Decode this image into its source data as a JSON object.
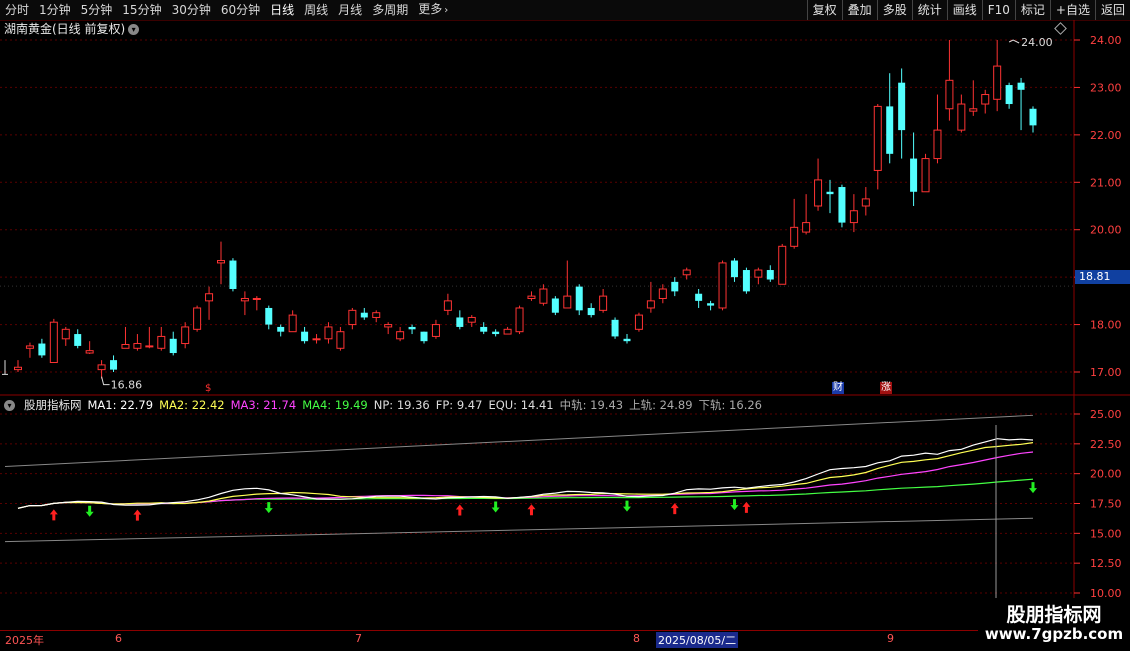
{
  "toolbar": {
    "tabs": [
      "分时",
      "1分钟",
      "5分钟",
      "15分钟",
      "30分钟",
      "60分钟",
      "日线",
      "周线",
      "月线",
      "多周期",
      "更多"
    ],
    "active_tab": "日线",
    "right_buttons": [
      "复权",
      "叠加",
      "多股",
      "统计",
      "画线",
      "F10",
      "标记",
      "+自选",
      "返回"
    ]
  },
  "header": {
    "title": "湖南黄金(日线 前复权)"
  },
  "indicator": {
    "name": "股朋指标网",
    "items": [
      {
        "label": "MA1: 22.79",
        "color": "#ffffff"
      },
      {
        "label": "MA2: 22.42",
        "color": "#ffff55"
      },
      {
        "label": "MA3: 21.74",
        "color": "#ff44ff"
      },
      {
        "label": "MA4: 19.49",
        "color": "#44ff44"
      },
      {
        "label": "NP: 19.36",
        "color": "#dddddd"
      },
      {
        "label": "FP: 9.47",
        "color": "#dddddd"
      },
      {
        "label": "EQU: 14.41",
        "color": "#dddddd"
      },
      {
        "label": "中轨: 19.43",
        "color": "#aaaaaa"
      },
      {
        "label": "上轨: 24.89",
        "color": "#aaaaaa"
      },
      {
        "label": "下轨: 16.26",
        "color": "#aaaaaa"
      }
    ]
  },
  "price_axis": [
    "24.00",
    "23.00",
    "22.00",
    "21.00",
    "20.00",
    "19.00",
    "18.00",
    "17.00"
  ],
  "indicator_axis": [
    "25.00",
    "22.50",
    "20.00",
    "17.50",
    "15.00",
    "12.50",
    "10.00"
  ],
  "current_price": "18.81",
  "high_label": "24.00",
  "low_label": "16.86",
  "badges": {
    "cai": "财",
    "zhang": "涨"
  },
  "dates": {
    "year": "2025年",
    "m6": "6",
    "m7": "7",
    "m8": "8",
    "m9": "9",
    "selected": "2025/08/05/二"
  },
  "watermark": {
    "line1": "股朋指标网",
    "line2": "www.7gpzb.com"
  },
  "colors": {
    "up": "#ff3333",
    "down": "#54ffff",
    "grid": "#5a0000"
  },
  "chart_data": {
    "type": "candlestick",
    "price_range": [
      16.6,
      24.4
    ],
    "indicator_range": [
      10,
      25.5
    ],
    "candles": [
      [
        17.05,
        17.1,
        17.25,
        17.0
      ],
      [
        17.5,
        17.55,
        17.62,
        17.3
      ],
      [
        17.6,
        17.35,
        17.7,
        17.3
      ],
      [
        17.2,
        18.05,
        18.12,
        17.2
      ],
      [
        17.7,
        17.9,
        17.95,
        17.55
      ],
      [
        17.8,
        17.55,
        17.9,
        17.5
      ],
      [
        17.4,
        17.45,
        17.65,
        17.38
      ],
      [
        17.05,
        17.15,
        17.25,
        16.86
      ],
      [
        17.25,
        17.05,
        17.35,
        17.0
      ],
      [
        17.5,
        17.58,
        17.95,
        17.5
      ],
      [
        17.5,
        17.6,
        17.8,
        17.45
      ],
      [
        17.55,
        17.55,
        17.95,
        17.5
      ],
      [
        17.5,
        17.75,
        17.95,
        17.45
      ],
      [
        17.7,
        17.4,
        17.85,
        17.35
      ],
      [
        17.6,
        17.95,
        18.05,
        17.5
      ],
      [
        17.9,
        18.35,
        18.4,
        17.85
      ],
      [
        18.5,
        18.65,
        18.8,
        18.1
      ],
      [
        19.3,
        19.35,
        19.75,
        18.85
      ],
      [
        19.35,
        18.75,
        19.4,
        18.7
      ],
      [
        18.5,
        18.55,
        18.7,
        18.2
      ],
      [
        18.55,
        18.55,
        18.6,
        18.3
      ],
      [
        18.35,
        18.0,
        18.4,
        17.9
      ],
      [
        17.95,
        17.85,
        18.0,
        17.75
      ],
      [
        17.85,
        18.2,
        18.3,
        17.85
      ],
      [
        17.85,
        17.65,
        17.95,
        17.6
      ],
      [
        17.7,
        17.7,
        17.8,
        17.6
      ],
      [
        17.7,
        17.95,
        18.05,
        17.6
      ],
      [
        17.5,
        17.85,
        17.95,
        17.45
      ],
      [
        18.0,
        18.3,
        18.35,
        17.9
      ],
      [
        18.25,
        18.15,
        18.35,
        18.1
      ],
      [
        18.15,
        18.25,
        18.3,
        18.05
      ],
      [
        17.95,
        18.0,
        18.05,
        17.8
      ],
      [
        17.7,
        17.85,
        17.95,
        17.65
      ],
      [
        17.95,
        17.9,
        18.0,
        17.8
      ],
      [
        17.85,
        17.65,
        17.85,
        17.6
      ],
      [
        17.75,
        18.0,
        18.1,
        17.7
      ],
      [
        18.3,
        18.5,
        18.65,
        18.2
      ],
      [
        18.15,
        17.95,
        18.3,
        17.9
      ],
      [
        18.05,
        18.15,
        18.2,
        17.95
      ],
      [
        17.95,
        17.85,
        18.05,
        17.8
      ],
      [
        17.85,
        17.8,
        17.9,
        17.75
      ],
      [
        17.8,
        17.9,
        17.95,
        17.8
      ],
      [
        17.85,
        18.35,
        18.4,
        17.8
      ],
      [
        18.55,
        18.6,
        18.7,
        18.5
      ],
      [
        18.45,
        18.75,
        18.85,
        18.4
      ],
      [
        18.55,
        18.25,
        18.6,
        18.2
      ],
      [
        18.35,
        18.6,
        19.35,
        18.35
      ],
      [
        18.8,
        18.3,
        18.85,
        18.2
      ],
      [
        18.35,
        18.2,
        18.45,
        18.15
      ],
      [
        18.3,
        18.6,
        18.75,
        18.25
      ],
      [
        18.1,
        17.75,
        18.15,
        17.7
      ],
      [
        17.7,
        17.65,
        17.8,
        17.6
      ],
      [
        17.9,
        18.2,
        18.25,
        17.85
      ],
      [
        18.35,
        18.5,
        18.9,
        18.25
      ],
      [
        18.55,
        18.75,
        18.85,
        18.45
      ],
      [
        18.9,
        18.7,
        19.0,
        18.6
      ],
      [
        19.05,
        19.15,
        19.2,
        18.95
      ],
      [
        18.65,
        18.5,
        18.75,
        18.35
      ],
      [
        18.45,
        18.4,
        18.5,
        18.3
      ],
      [
        18.35,
        19.3,
        19.35,
        18.3
      ],
      [
        19.35,
        19.0,
        19.4,
        18.9
      ],
      [
        19.15,
        18.7,
        19.2,
        18.65
      ],
      [
        19.0,
        19.15,
        19.2,
        18.85
      ],
      [
        19.15,
        18.95,
        19.25,
        18.9
      ],
      [
        18.85,
        19.65,
        19.7,
        18.85
      ],
      [
        19.65,
        20.05,
        20.65,
        19.6
      ],
      [
        19.95,
        20.15,
        20.75,
        19.9
      ],
      [
        20.5,
        21.05,
        21.5,
        20.4
      ],
      [
        20.8,
        20.75,
        21.05,
        20.35
      ],
      [
        20.9,
        20.15,
        20.95,
        20.05
      ],
      [
        20.15,
        20.4,
        20.75,
        19.95
      ],
      [
        20.5,
        20.65,
        20.9,
        20.3
      ],
      [
        21.25,
        22.6,
        22.65,
        20.85
      ],
      [
        22.6,
        21.6,
        23.3,
        21.4
      ],
      [
        23.1,
        22.1,
        23.4,
        21.5
      ],
      [
        21.5,
        20.8,
        22.05,
        20.5
      ],
      [
        20.8,
        21.5,
        21.6,
        20.8
      ],
      [
        21.5,
        22.1,
        22.85,
        21.4
      ],
      [
        22.55,
        23.15,
        24.0,
        22.3
      ],
      [
        22.1,
        22.65,
        22.85,
        22.05
      ],
      [
        22.5,
        22.55,
        23.15,
        22.4
      ],
      [
        22.65,
        22.85,
        22.95,
        22.45
      ],
      [
        22.75,
        23.45,
        24.0,
        22.5
      ],
      [
        23.05,
        22.65,
        23.1,
        22.55
      ],
      [
        23.1,
        22.95,
        23.2,
        22.1
      ],
      [
        22.55,
        22.2,
        22.6,
        22.05
      ]
    ],
    "ma_lines": [
      "MA1",
      "MA2",
      "MA3",
      "MA4"
    ]
  }
}
